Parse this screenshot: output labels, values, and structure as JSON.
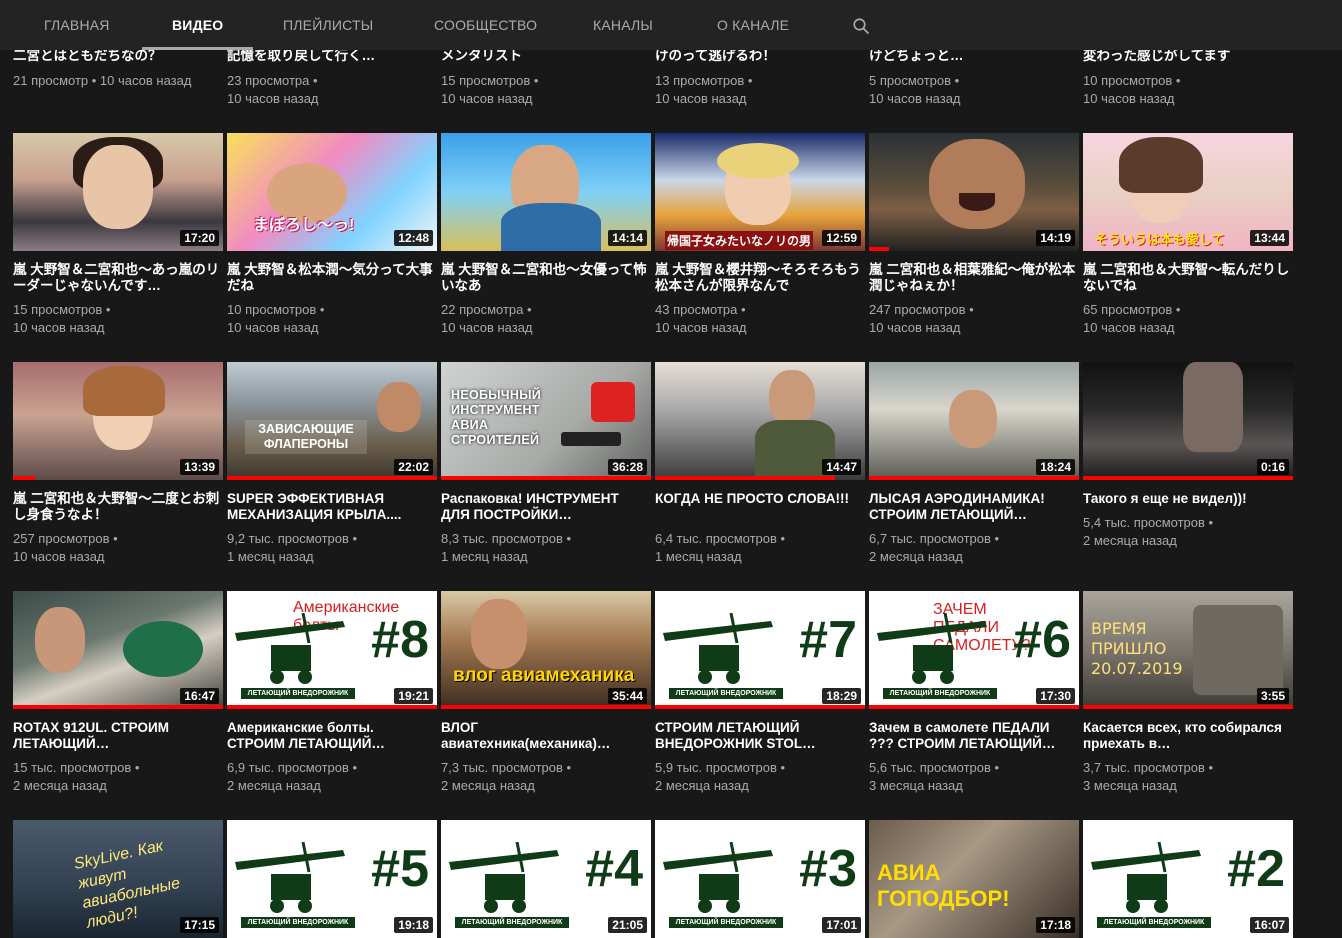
{
  "nav": {
    "tabs": [
      {
        "label": "ГЛАВНАЯ"
      },
      {
        "label": "ВИДЕО"
      },
      {
        "label": "ПЛЕЙЛИСТЫ"
      },
      {
        "label": "СООБЩЕСТВО"
      },
      {
        "label": "КАНАЛЫ"
      },
      {
        "label": "О КАНАЛЕ"
      }
    ],
    "active_tab": "ВИДЕО",
    "search_icon": "search-icon"
  },
  "rows": [
    {
      "videos": [
        {
          "title": "二宮とはともだちなの？",
          "views": "21 просмотр",
          "age": "10 часов назад"
        },
        {
          "title": "記憶を取り戻して行く…",
          "views": "23 просмотра",
          "age": "10 часов назад"
        },
        {
          "title": "メンタリスト",
          "views": "15 просмотров",
          "age": "10 часов назад"
        },
        {
          "title": "けのって逃げるわ！",
          "views": "13 просмотров",
          "age": "10 часов назад"
        },
        {
          "title": "けどちょっと…",
          "views": "5 просмотров",
          "age": "10 часов назад"
        },
        {
          "title": "変わった感じがしてます",
          "views": "10 просмотров",
          "age": "10 часов назад"
        }
      ]
    },
    {
      "videos": [
        {
          "title": "嵐 大野智＆二宮和也～あっ嵐のリーダーじゃないんです…",
          "views": "15 просмотров",
          "age": "10 часов назад",
          "duration": "17:20"
        },
        {
          "title": "嵐 大野智＆松本潤～気分って大事だね",
          "views": "10 просмотров",
          "age": "10 часов назад",
          "duration": "12:48",
          "overlay": "まぼろし〜っ!"
        },
        {
          "title": "嵐 大野智＆二宮和也～女優って怖いなあ",
          "views": "22 просмотра",
          "age": "10 часов назад",
          "duration": "14:14"
        },
        {
          "title": "嵐 大野智＆櫻井翔～そろそろもう松本さんが限界なんで",
          "views": "43 просмотра",
          "age": "10 часов назад",
          "duration": "12:59",
          "overlay": "帰国子女みたいなノリの男"
        },
        {
          "title": "嵐 二宮和也＆相葉雅紀～俺が松本潤じゃねぇか！",
          "views": "247 просмотров",
          "age": "10 часов назад",
          "duration": "14:19"
        },
        {
          "title": "嵐 二宮和也＆大野智～転んだりしないでね",
          "views": "65 просмотров",
          "age": "10 часов назад",
          "duration": "13:44",
          "overlay": "そういうは本も愛して"
        }
      ]
    },
    {
      "videos": [
        {
          "title": "嵐 二宮和也＆大野智～二度とお刺し身食うなよ！",
          "views": "257 просмотров",
          "age": "10 часов назад",
          "duration": "13:39"
        },
        {
          "title": "SUPER ЭФФЕКТИВНАЯ МЕХАНИЗАЦИЯ КРЫЛА....",
          "views": "9,2 тыс. просмотров",
          "age": "1 месяц назад",
          "duration": "22:02",
          "overlay": "ЗАВИСАЮЩИЕ ФЛАПЕРОНЫ"
        },
        {
          "title": "Распаковка! ИНСТРУМЕНТ ДЛЯ ПОСТРОЙКИ…",
          "views": "8,3 тыс. просмотров",
          "age": "1 месяц назад",
          "duration": "36:28",
          "overlay": "НЕОБЫЧНЫЙ ИНСТРУМЕНТ АВИА СТРОИТЕЛЕЙ"
        },
        {
          "title": "КОГДА НЕ ПРОСТО СЛОВА!!!",
          "views": "6,4 тыс. просмотров",
          "age": "1 месяц назад",
          "duration": "14:47"
        },
        {
          "title": "ЛЫСАЯ АЭРОДИНАМИКА! СТРОИМ ЛЕТАЮЩИЙ…",
          "views": "6,7 тыс. просмотров",
          "age": "2 месяца назад",
          "duration": "18:24"
        },
        {
          "title": "Такого я еще не видел))!",
          "views": "5,4 тыс. просмотров",
          "age": "2 месяца назад",
          "duration": "0:16"
        }
      ]
    },
    {
      "videos": [
        {
          "title": "ROTAX 912UL. СТРОИМ ЛЕТАЮЩИЙ…",
          "views": "15 тыс. просмотров",
          "age": "2 месяца назад",
          "duration": "16:47"
        },
        {
          "title": "Американские болты. СТРОИМ ЛЕТАЮЩИЙ…",
          "views": "6,9 тыс. просмотров",
          "age": "2 месяца назад",
          "duration": "19:21",
          "overlay": "Американские болты",
          "number": "#8",
          "badge": "ЛЕТАЮЩИЙ ВНЕДОРОЖНИК"
        },
        {
          "title": "ВЛОГ авиатехника(механика)…",
          "views": "7,3 тыс. просмотров",
          "age": "2 месяца назад",
          "duration": "35:44",
          "overlay": "влог авиамеханика"
        },
        {
          "title": "СТРОИМ ЛЕТАЮЩИЙ ВНЕДОРОЖНИК STOL…",
          "views": "5,9 тыс. просмотров",
          "age": "2 месяца назад",
          "duration": "18:29",
          "number": "#7",
          "badge": "ЛЕТАЮЩИЙ ВНЕДОРОЖНИК"
        },
        {
          "title": "Зачем в самолете ПЕДАЛИ ??? СТРОИМ ЛЕТАЮЩИЙ…",
          "views": "5,6 тыс. просмотров",
          "age": "3 месяца назад",
          "duration": "17:30",
          "overlay": "ЗАЧЕМ ПЕДАЛИ САМОЛЕТУ?",
          "number": "#6",
          "badge": "ЛЕТАЮЩИЙ ВНЕДОРОЖНИК"
        },
        {
          "title": "Касается всех, кто собирался приехать в…",
          "views": "3,7 тыс. просмотров",
          "age": "3 месяца назад",
          "duration": "3:55",
          "overlay": "ВРЕМЯ ПРИШЛО 20.07.2019"
        }
      ]
    },
    {
      "videos": [
        {
          "title": "",
          "views": "",
          "age": "",
          "duration": "17:15",
          "overlay": "SkyLive. Как живут авиабольные люди?!"
        },
        {
          "title": "",
          "views": "",
          "age": "",
          "duration": "19:18",
          "number": "#5",
          "badge": "ЛЕТАЮЩИЙ ВНЕДОРОЖНИК"
        },
        {
          "title": "",
          "views": "",
          "age": "",
          "duration": "21:05",
          "number": "#4",
          "badge": "ЛЕТАЮЩИЙ ВНЕДОРОЖНИК"
        },
        {
          "title": "",
          "views": "",
          "age": "",
          "duration": "17:01",
          "number": "#3",
          "badge": "ЛЕТАЮЩИЙ ВНЕДОРОЖНИК"
        },
        {
          "title": "",
          "views": "",
          "age": "",
          "duration": "17:18",
          "overlay": "АВИА ГОПОДБОР!"
        },
        {
          "title": "",
          "views": "",
          "age": "",
          "duration": "16:07",
          "number": "#2",
          "badge": "ЛЕТАЮЩИЙ ВНЕДОРОЖНИК"
        }
      ]
    }
  ],
  "colors": {
    "progress": "#ff0000",
    "background": "#181818",
    "topbar": "#232323",
    "meta_text": "#aaaaaa"
  }
}
